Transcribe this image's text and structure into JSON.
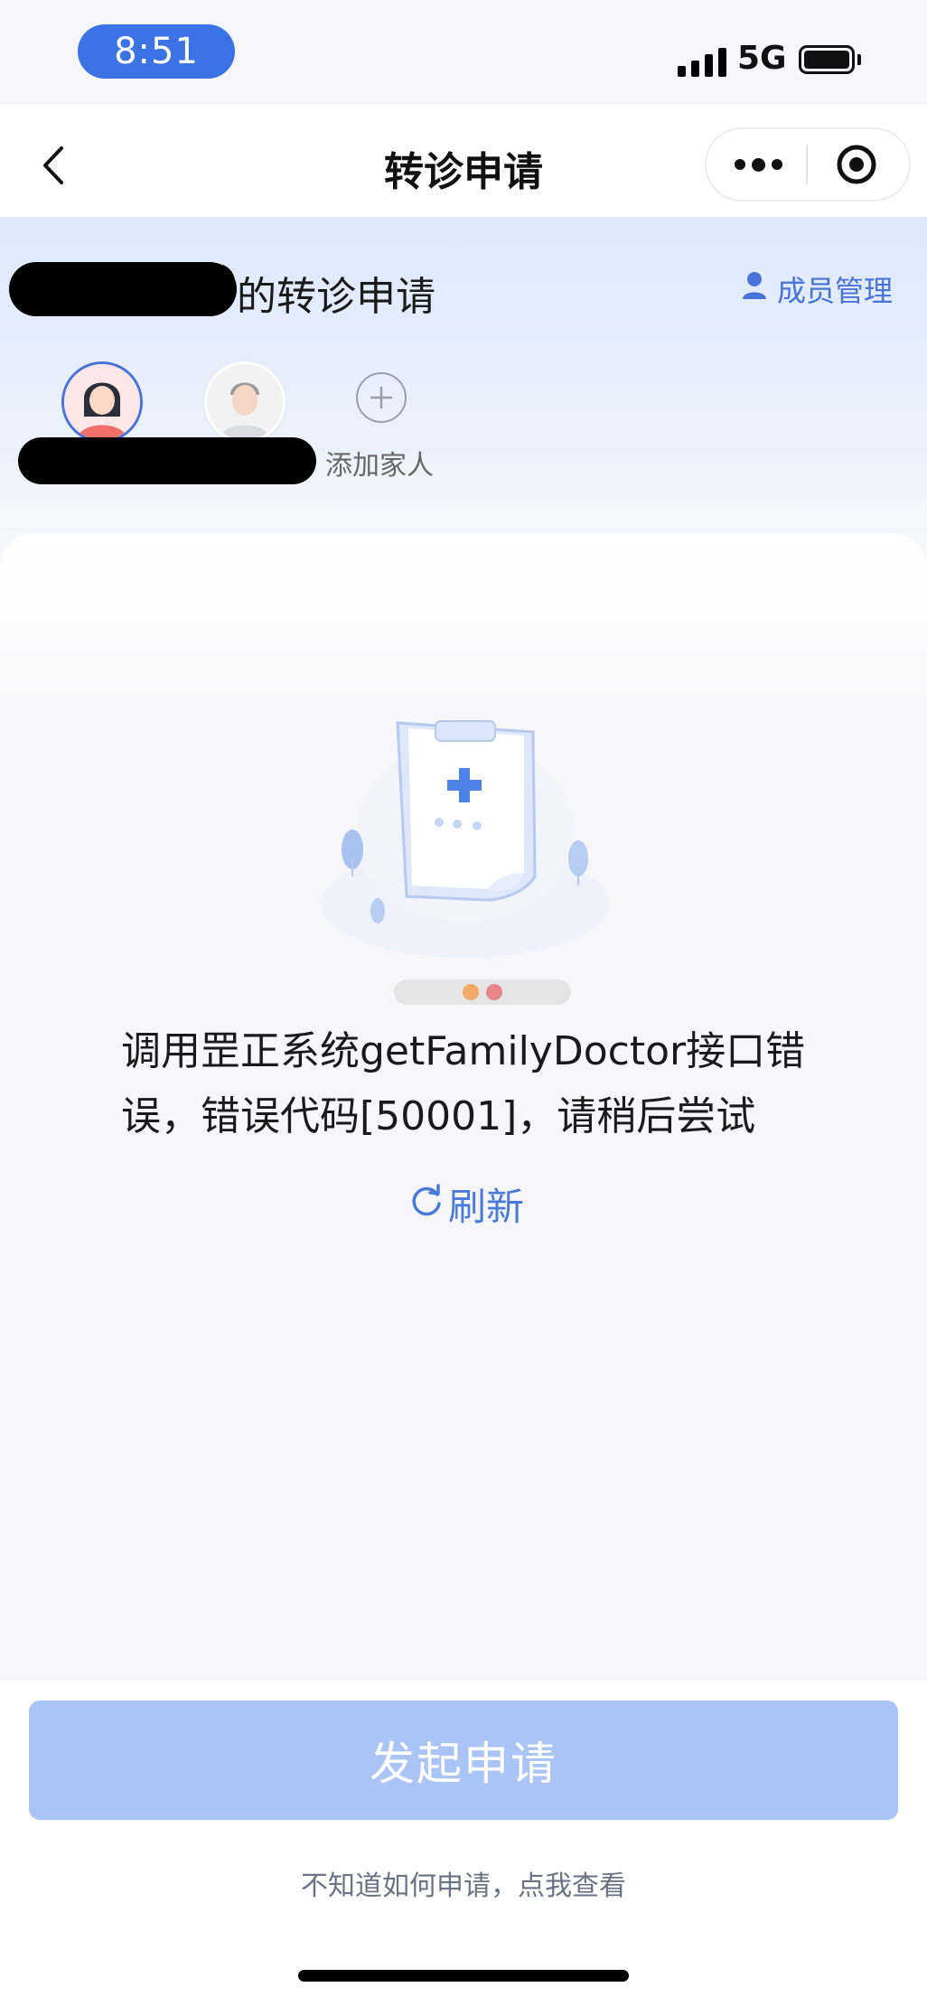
{
  "status_bar": {
    "time": "8:51",
    "network": "5G"
  },
  "nav": {
    "title": "转诊申请"
  },
  "header": {
    "title_suffix": "的转诊申请",
    "member_management": "成员管理",
    "add_family": "添加家人"
  },
  "error": {
    "message": "调用罡正系统getFamilyDoctor接口错误，错误代码[50001]，请稍后尝试",
    "refresh_label": "刷新"
  },
  "footer": {
    "submit_label": "发起申请",
    "help_link": "不知道如何申请，点我查看"
  },
  "icons": {
    "back": "chevron-left-icon",
    "more": "more-dots-icon",
    "close": "target-close-icon",
    "member": "person-icon",
    "add": "plus-circle-icon",
    "refresh": "refresh-icon"
  },
  "colors": {
    "accent": "#3b73e4",
    "link": "#4a73d8",
    "button_disabled": "#abc4f6"
  }
}
